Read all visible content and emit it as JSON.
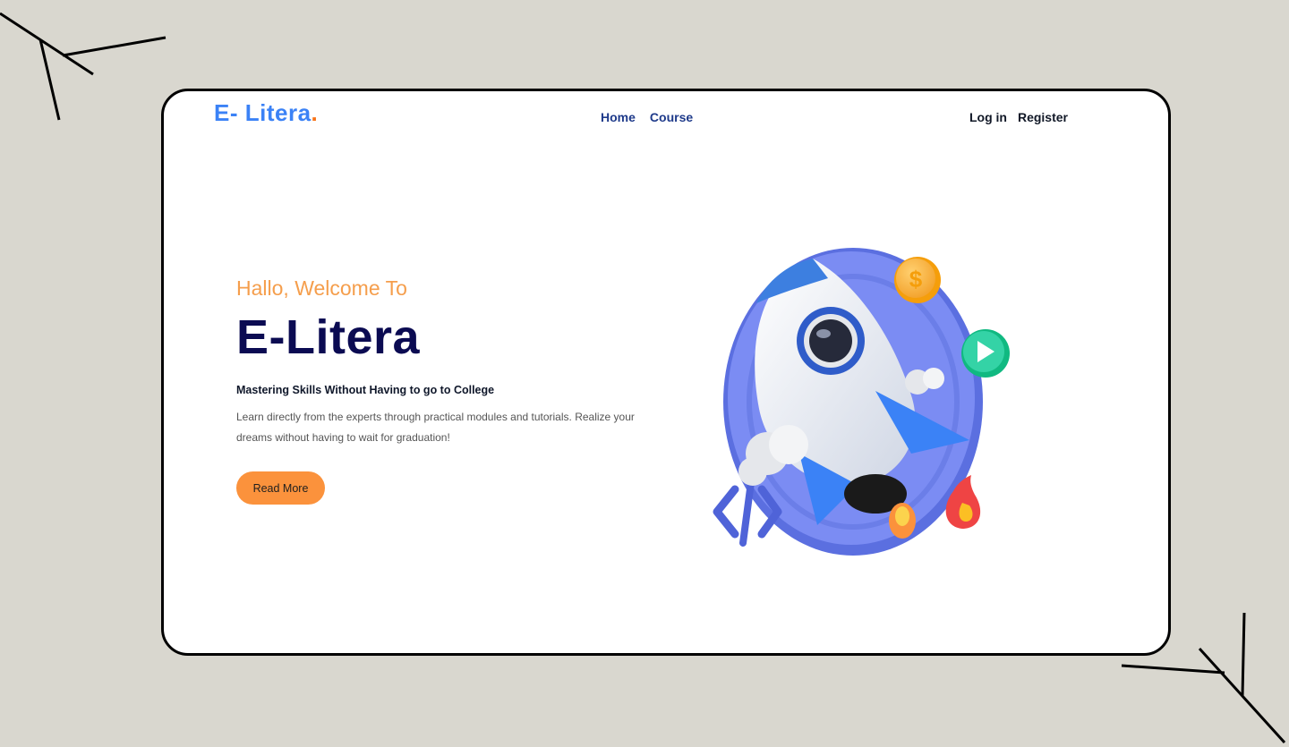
{
  "brand": {
    "name": "E- Litera",
    "dot": ".",
    "colors": {
      "primary": "#3b82f6",
      "accent": "#f97316",
      "navy": "#0b0b52"
    }
  },
  "nav": {
    "items": [
      {
        "label": "Home"
      },
      {
        "label": "Course"
      }
    ]
  },
  "auth": {
    "login_label": "Log in",
    "register_label": "Register"
  },
  "hero": {
    "greeting": "Hallo, Welcome To",
    "title": "E-Litera",
    "subtitle": "Mastering Skills Without Having to go to College",
    "description": "Learn directly from the experts through practical modules and tutorials. Realize your dreams without having to wait for graduation!",
    "cta_label": "Read More"
  },
  "illustration": {
    "icons": [
      "rocket-icon",
      "dollar-coin-icon",
      "play-icon",
      "code-brackets-icon",
      "flame-icon",
      "cloud-icon"
    ],
    "coin_symbol": "$"
  }
}
